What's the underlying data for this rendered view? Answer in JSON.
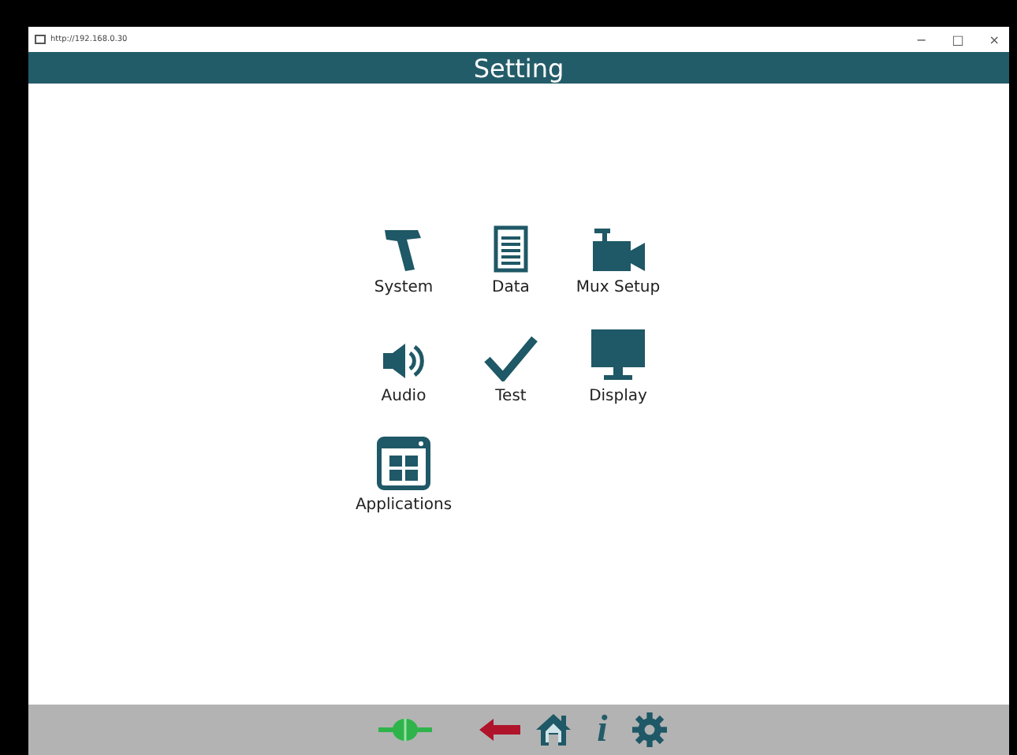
{
  "window": {
    "address": "http://192.168.0.30",
    "controls": [
      "−",
      "□",
      "×"
    ]
  },
  "header": {
    "title": "Setting"
  },
  "items": [
    {
      "label": "System",
      "kind": "hammer"
    },
    {
      "label": "Data",
      "kind": "document"
    },
    {
      "label": "Mux Setup",
      "kind": "camera"
    },
    {
      "label": "Audio",
      "kind": "speaker"
    },
    {
      "label": "Test",
      "kind": "check"
    },
    {
      "label": "Display",
      "kind": "monitor"
    },
    {
      "label": "Applications",
      "kind": "apps"
    }
  ],
  "footer": {
    "buttons": [
      {
        "kind": "plug"
      },
      {
        "kind": "back"
      },
      {
        "kind": "home"
      },
      {
        "kind": "info",
        "text": "i"
      },
      {
        "kind": "gear"
      }
    ]
  }
}
